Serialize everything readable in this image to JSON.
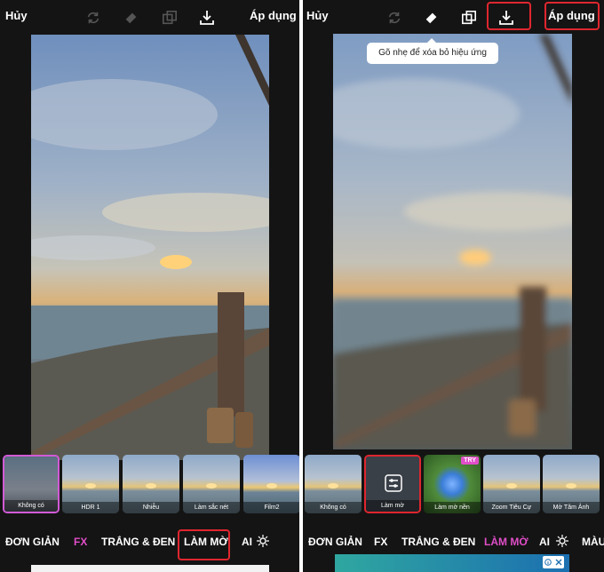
{
  "left": {
    "cancel": "Hủy",
    "apply": "Áp dụng",
    "thumbs": [
      "Không có",
      "HDR 1",
      "Nhiễu",
      "Làm sắc nét",
      "Film2"
    ],
    "tabs": [
      "ĐƠN GIẢN",
      "FX",
      "TRẮNG & ĐEN",
      "LÀM MỜ",
      "AI"
    ],
    "active_tab": "FX"
  },
  "right": {
    "cancel": "Hủy",
    "apply": "Áp dụng",
    "tooltip": "Gõ nhẹ để xóa bỏ hiệu ứng",
    "thumbs": [
      "Không có",
      "Làm mờ",
      "Làm mờ nền",
      "Zoom Tiêu Cự",
      "Mờ Tâm Ảnh"
    ],
    "try_badge": "TRY",
    "tabs": [
      "ĐƠN GIẢN",
      "FX",
      "TRẮNG & ĐEN",
      "LÀM MỜ",
      "AI",
      "MÀU"
    ],
    "active_tab": "LÀM MỜ"
  },
  "colors": {
    "background": "#141414",
    "highlight": "#e0262f",
    "active_tab": "#e04ec8"
  },
  "icons": [
    "redo-icon",
    "eraser-icon",
    "compare-icon",
    "download-icon",
    "settings-icon",
    "close-icon"
  ]
}
